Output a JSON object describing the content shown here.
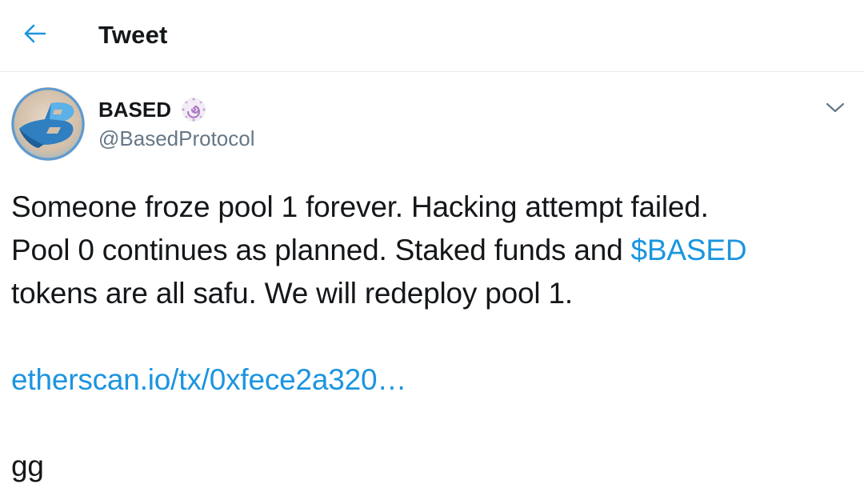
{
  "header": {
    "title": "Tweet",
    "back_icon": "arrow-left-icon"
  },
  "author": {
    "name": "BASED",
    "handle": "@BasedProtocol",
    "badge_icon": "swirl-emoji-icon",
    "avatar_icon": "based-logo-icon",
    "menu_icon": "chevron-down-icon"
  },
  "tweet": {
    "line1": "Someone froze pool 1 forever. Hacking attempt failed.",
    "line2_prefix": "Pool 0 continues as planned. Staked funds and ",
    "cashtag": "$BASED",
    "line3": "tokens are all safu. We will redeploy pool 1.",
    "link": "etherscan.io/tx/0xfece2a320…",
    "closing": "gg"
  },
  "colors": {
    "link": "#1b95e0",
    "text": "#14171a",
    "secondary": "#657786",
    "divider": "#e6ecf0"
  }
}
